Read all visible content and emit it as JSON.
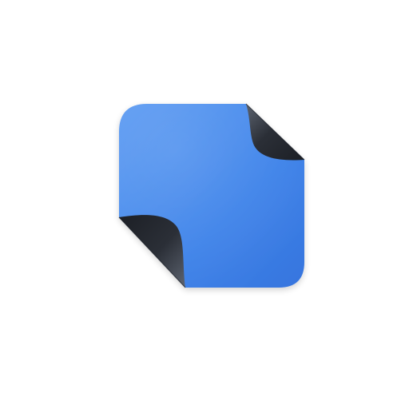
{
  "icon": {
    "semantic": "sticky-note-icon",
    "colors": {
      "background": "#ffffff",
      "note_light": "#5b9af2",
      "note_mid": "#3f84ea",
      "note_dark": "#3675de",
      "curl_light": "#5d6470",
      "curl_dark": "#1c1f25",
      "curl_edge": "#0f1115"
    }
  }
}
